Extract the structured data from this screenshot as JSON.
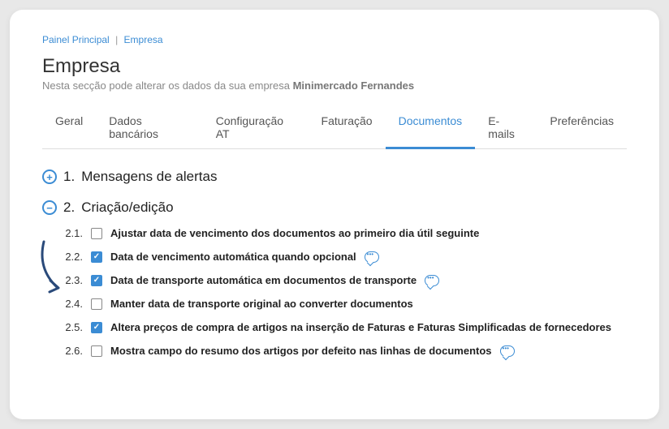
{
  "breadcrumb": {
    "root": "Painel Principal",
    "current": "Empresa"
  },
  "page": {
    "title": "Empresa",
    "subtitle_prefix": "Nesta secção pode alterar os dados da sua empresa ",
    "company": "Minimercado Fernandes"
  },
  "tabs": [
    {
      "label": "Geral",
      "active": false
    },
    {
      "label": "Dados bancários",
      "active": false
    },
    {
      "label": "Configuração AT",
      "active": false
    },
    {
      "label": "Faturação",
      "active": false
    },
    {
      "label": "Documentos",
      "active": true
    },
    {
      "label": "E-mails",
      "active": false
    },
    {
      "label": "Preferências",
      "active": false
    }
  ],
  "sections": {
    "s1": {
      "num": "1.",
      "title": "Mensagens de alertas",
      "expanded": false
    },
    "s2": {
      "num": "2.",
      "title": "Criação/edição",
      "expanded": true,
      "options": [
        {
          "num": "2.1.",
          "label": "Ajustar data de vencimento dos documentos ao primeiro dia útil seguinte",
          "checked": false,
          "info": false
        },
        {
          "num": "2.2.",
          "label": "Data de vencimento automática quando opcional",
          "checked": true,
          "info": true
        },
        {
          "num": "2.3.",
          "label": "Data de transporte automática em documentos de transporte",
          "checked": true,
          "info": true
        },
        {
          "num": "2.4.",
          "label": "Manter data de transporte original ao converter documentos",
          "checked": false,
          "info": false
        },
        {
          "num": "2.5.",
          "label": "Altera preços de compra de artigos na inserção de Faturas e Faturas Simplificadas de fornecedores",
          "checked": true,
          "info": false
        },
        {
          "num": "2.6.",
          "label": "Mostra campo do resumo dos artigos por defeito nas linhas de documentos",
          "checked": false,
          "info": true
        }
      ]
    }
  },
  "icons": {
    "expand": "+",
    "collapse": "−"
  }
}
